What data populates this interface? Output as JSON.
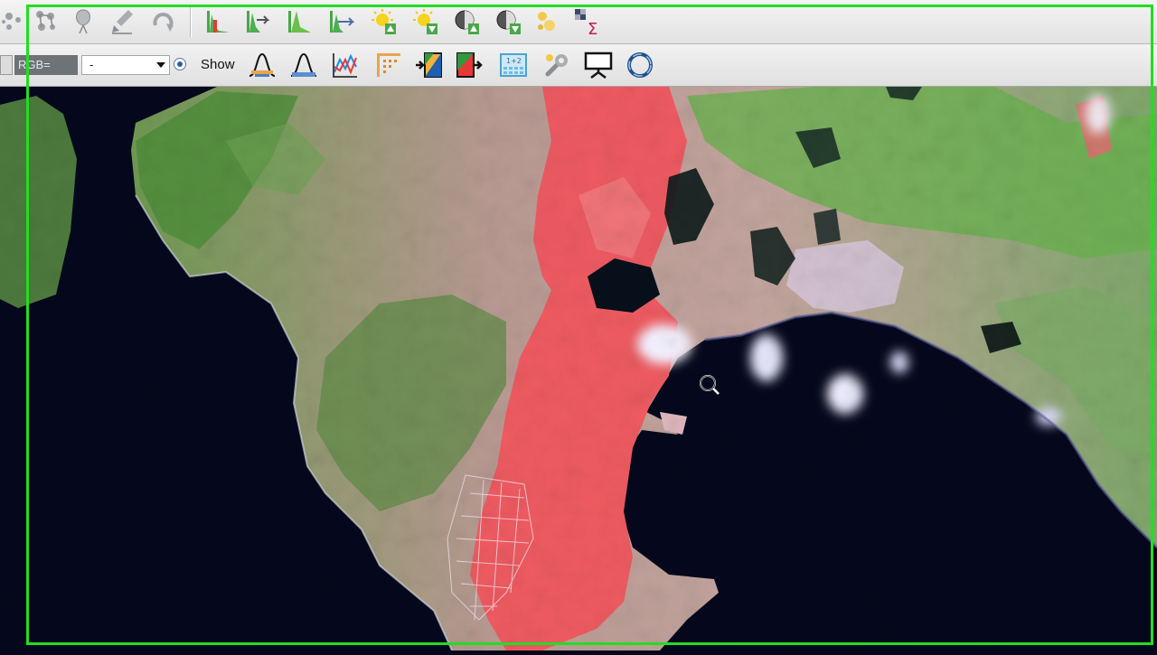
{
  "toolbar_row1": {
    "icons": [
      "cluster-icon",
      "cluster-nodes-icon",
      "balloon-icon",
      "brush-edit-icon",
      "redo-icon",
      "histogram-red-icon",
      "histogram-arrow-icon",
      "histogram-green-icon",
      "histogram-transfer-icon",
      "sun-up-icon",
      "sun-down-icon",
      "contrast-up-icon",
      "contrast-down-icon",
      "beads-icon",
      "pixel-sum-icon"
    ]
  },
  "toolbar_row2": {
    "rgb_label": "RGB=",
    "rgb_value": "-",
    "show_label": "Show",
    "icons": [
      "gaussian-curve-icon",
      "bell-curve-icon",
      "spectral-plot-icon",
      "scatter-tool-icon",
      "band-stack-forward-icon",
      "band-stack-red-icon",
      "band-calculator-icon",
      "settings-wrench-icon",
      "display-screen-icon",
      "refresh-ring-icon"
    ]
  },
  "map": {
    "description_colors": {
      "sea": "#050a24",
      "burned": "#ef5a5e",
      "vegetation": "#5f9a45",
      "bare_soil": "#c8a6a0",
      "cloud": "#f2f2ff"
    }
  },
  "highlight_color": "#22dd22"
}
